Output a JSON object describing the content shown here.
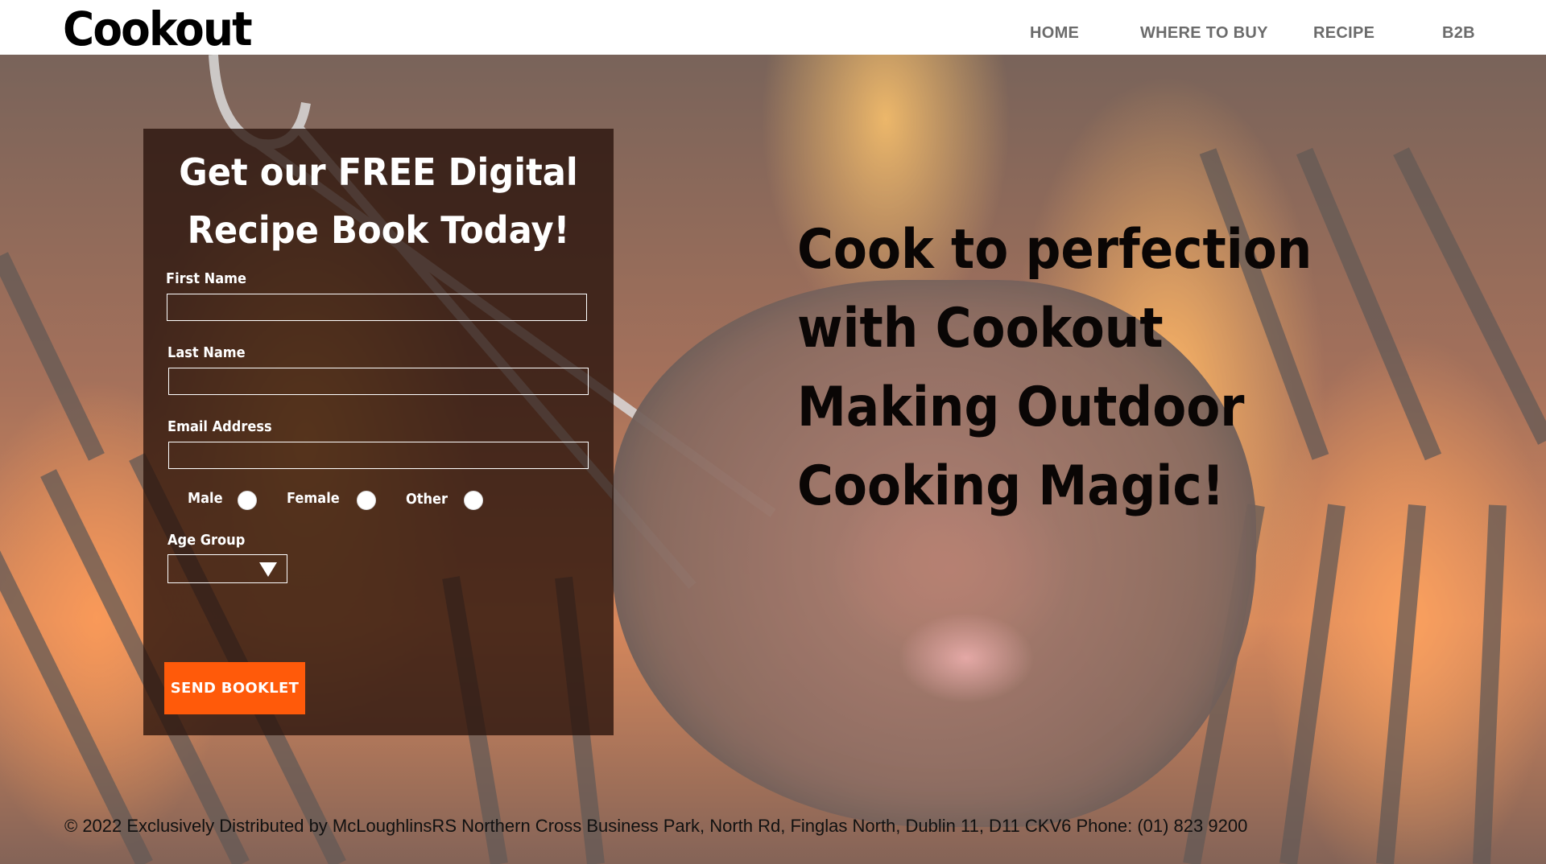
{
  "header": {
    "logo": "Cookout",
    "nav": [
      {
        "label": "HOME"
      },
      {
        "label": "WHERE TO BUY"
      },
      {
        "label": "RECIPE"
      },
      {
        "label": "B2B"
      }
    ]
  },
  "form": {
    "title_line1": "Get our FREE Digital",
    "title_line2": "Recipe Book Today!",
    "first_name_label": "First Name",
    "first_name_value": "",
    "last_name_label": "Last Name",
    "last_name_value": "",
    "email_label": "Email Address",
    "email_value": "",
    "gender_options": [
      "Male",
      "Female",
      "Other"
    ],
    "age_group_label": "Age Group",
    "age_group_value": "",
    "submit_label": "SEND BOOKLET"
  },
  "hero": {
    "headline_lines": [
      "Cook to perfection",
      "with Cookout",
      "Making Outdoor",
      "Cooking Magic!"
    ]
  },
  "footer": {
    "text": "© 2022 Exclusively Distributed by McLoughlinsRS Northern Cross Business Park, North Rd, Finglas North, Dublin 11, D11 CKV6   Phone: (01) 823 9200"
  },
  "colors": {
    "accent_button": "#ff5a0a",
    "nav_text": "#6b6b6b",
    "panel_bg": "#28120a"
  }
}
